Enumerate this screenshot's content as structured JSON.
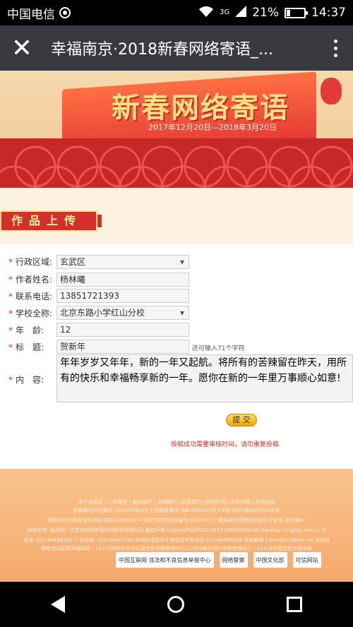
{
  "status_bar": {
    "carrier": "中国电信",
    "network": "3G",
    "battery_percent_text": "21%",
    "battery_level": 0.21,
    "time": "14:37"
  },
  "title_bar": {
    "title": "幸福南京·2018新春网络寄语_..."
  },
  "banner": {
    "title": "新春网络寄语",
    "dates": "2017年12月20日—2018年3月20日"
  },
  "section": {
    "title": "作品上传"
  },
  "form": {
    "district": {
      "label": "行政区域:",
      "value": "玄武区"
    },
    "author": {
      "label": "作者姓名:",
      "value": "杨林曦"
    },
    "phone": {
      "label": "联系电话:",
      "value": "13851721393"
    },
    "school": {
      "label": "学校全称:",
      "value": "北京东路小学红山分校"
    },
    "age": {
      "label": "年　龄:",
      "value": "12"
    },
    "title_field": {
      "label": "标　题:",
      "value": "贺新年",
      "hint": "还可输入71个字符"
    },
    "content": {
      "label": "内　容:",
      "value": "年年岁岁又年年，新的一年又起航。将所有的苦辣留在昨天，用所有的快乐和幸福畅享新的一年。愿你在新的一年里万事顺心如意!"
    },
    "submit_label": "提 交",
    "notice": "投稿成功需要审核时间，请勿重复投稿"
  },
  "footer": {
    "links": "关于龙虎网 | 广告服务 | 家长监护 | 法律顾问 | 联系我们 | 网站声明 | 本网招聘 | 本网动态",
    "line1": "国新网许可证编号--3212006004 工信部备案号:苏B-20040074 ICP证:苏ICP备09101006号",
    "line2": "增值电信业务经营许可证:苏B2-20040074 视听节目许可证编号:1004072 广播电视节目制作经营许可证号:苏字第47",
    "line3": "版权所有: 龙虎网 · 江苏龙虎网信息科技股份有限公司 版权声明 Copyright@2002-2013 LONGHOO.net,Nanjing Longhoo.net,Inc.A",
    "line4": "电话: 025-84686249 广告热线: 025-84687180 本网站违法和不良信息举报电话 025-84686249 举报邮箱 jubao@longhoo.net 苏网发",
    "line5": "网络违法犯罪举报网站 | 12321网络不良与垃圾信息举报受理中心|12300电信用户申诉受理中心 | 12318全国文化市场举报",
    "badge1": "中国互联网 违法和不良信息举报中心",
    "badge2": "网络警察",
    "badge3": "中国文化部",
    "badge4": "可信网站"
  }
}
